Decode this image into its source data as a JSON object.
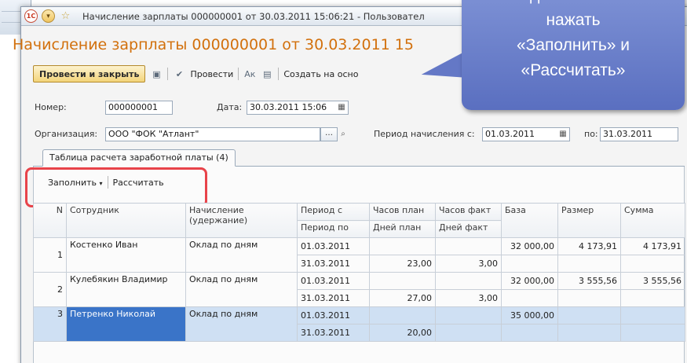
{
  "window": {
    "title": "Начисление зарплаты 000000001 от 30.03.2011 15:06:21 - Пользовател"
  },
  "document": {
    "title": "Начисление зарплаты 000000001 от 30.03.2011 15"
  },
  "toolbar": {
    "post_close": "Провести и закрыть",
    "post": "Провести",
    "create_based": "Создать на осно"
  },
  "fields": {
    "number_label": "Номер:",
    "number_value": "000000001",
    "date_label": "Дата:",
    "date_value": "30.03.2011 15:06",
    "org_label": "Организация:",
    "org_value": "ООО \"ФОК \"Атлант\"",
    "period_label": "Период начисления с:",
    "period_from": "01.03.2011",
    "period_to_label": "по:",
    "period_to": "31.03.2011"
  },
  "tab": {
    "label": "Таблица расчета заработной платы (4)"
  },
  "subtoolbar": {
    "fill": "Заполнить",
    "calc": "Рассчитать"
  },
  "grid": {
    "headers": {
      "n": "N",
      "employee": "Сотрудник",
      "accrual": "Начисление",
      "accrual2": "(удержание)",
      "period_from": "Период с",
      "period_to": "Период по",
      "hours_plan": "Часов план",
      "days_plan": "Дней план",
      "hours_fact": "Часов факт",
      "days_fact": "Дней факт",
      "base": "База",
      "size": "Размер",
      "sum": "Сумма"
    },
    "rows": [
      {
        "n": "1",
        "employee": "Костенко Иван",
        "accrual": "Оклад по дням",
        "from": "01.03.2011",
        "to": "31.03.2011",
        "days_plan": "23,00",
        "days_fact": "3,00",
        "base": "32 000,00",
        "size": "4 173,91",
        "sum": "4 173,91"
      },
      {
        "n": "2",
        "employee": "Кулебякин Владимир",
        "accrual": "Оклад по дням",
        "from": "01.03.2011",
        "to": "31.03.2011",
        "days_plan": "27,00",
        "days_fact": "3,00",
        "base": "32 000,00",
        "size": "3 555,56",
        "sum": "3 555,56"
      },
      {
        "n": "3",
        "employee": "Петренко Николай",
        "accrual": "Оклад по дням",
        "from": "01.03.2011",
        "to": "31.03.2011",
        "days_plan": "20,00",
        "days_fact": "",
        "base": "35 000,00",
        "size": "",
        "sum": ""
      }
    ]
  },
  "callout": {
    "line1": "достаточно",
    "line2": "нажать",
    "line3": "«Заполнить» и",
    "line4": "«Рассчитать»"
  },
  "colors": {
    "title_orange": "#d2700c",
    "highlight_red": "#e8434a",
    "callout_blue": "#6478c6",
    "selection_blue": "#3a74c8"
  }
}
